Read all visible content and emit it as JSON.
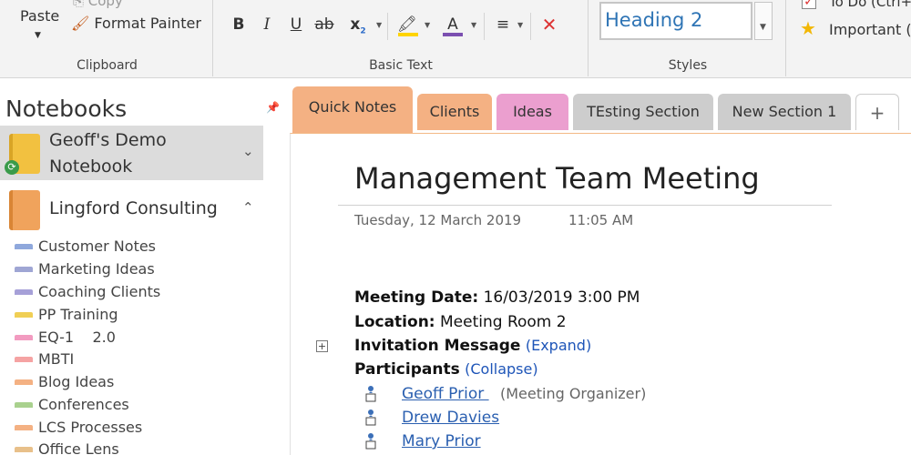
{
  "ribbon": {
    "clipboard": {
      "paste": "Paste",
      "copy": "Copy",
      "format_painter": "Format Painter",
      "label": "Clipboard"
    },
    "basic_text": {
      "label": "Basic Text",
      "bold": "B",
      "italic": "I",
      "underline": "U",
      "strike": "ab",
      "subscript": "x",
      "highlight_color": "#ffd400",
      "font_color": "#7b4fb0",
      "clear": "✕"
    },
    "styles": {
      "current": "Heading 2",
      "label": "Styles"
    },
    "tags": {
      "todo": "To Do (Ctrl+",
      "important": "Important ("
    }
  },
  "nav": {
    "title": "Notebooks",
    "notebooks": [
      {
        "name_line1": "Geoff's Demo",
        "name_line2": "Notebook",
        "color": "#f2c140",
        "expanded": false
      },
      {
        "name": "Lingford Consulting",
        "color": "#f0a35c",
        "expanded": true
      }
    ],
    "sections": [
      {
        "label": "Customer Notes",
        "color": "#8fa8dc"
      },
      {
        "label": "Marketing Ideas",
        "color": "#9fa6d4"
      },
      {
        "label": "Coaching Clients",
        "color": "#a6a0d8"
      },
      {
        "label": "PP Training",
        "color": "#f0cf55"
      },
      {
        "label": "EQ-1    2.0",
        "color": "#f29bc0"
      },
      {
        "label": "MBTI",
        "color": "#f5a3a3"
      },
      {
        "label": "Blog Ideas",
        "color": "#f4b183"
      },
      {
        "label": "Conferences",
        "color": "#a9d18e"
      },
      {
        "label": "LCS Processes",
        "color": "#f4b183"
      },
      {
        "label": "Office Lens",
        "color": "#e8c08a"
      }
    ]
  },
  "tabs": [
    {
      "label": "Quick Notes",
      "color": "#f4b183",
      "active": true
    },
    {
      "label": "Clients",
      "color": "#f4b183"
    },
    {
      "label": "Ideas",
      "color": "#eb9fcf"
    },
    {
      "label": "TEsting Section",
      "color": "#c8c8c8"
    },
    {
      "label": "New Section 1",
      "color": "#c8c8c8"
    },
    {
      "label": "+",
      "color": "#ffffff"
    }
  ],
  "page": {
    "title": "Management Team Meeting",
    "date": "Tuesday, 12 March 2019",
    "time": "11:05 AM",
    "meeting_date_label": "Meeting Date:",
    "meeting_date_value": " 16/03/2019 3:00 PM",
    "location_label": "Location:",
    "location_value": " Meeting Room 2",
    "invitation_label": "Invitation Message",
    "invitation_action": "(Expand)",
    "participants_label": "Participants",
    "participants_action": "(Collapse)",
    "participants": [
      {
        "name": "Geoff Prior ",
        "note": "(Meeting Organizer)"
      },
      {
        "name": "Drew Davies",
        "note": ""
      },
      {
        "name": "Mary Prior",
        "note": ""
      }
    ]
  }
}
